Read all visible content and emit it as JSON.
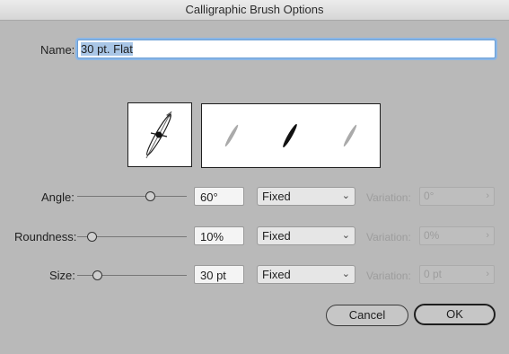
{
  "window": {
    "title": "Calligraphic Brush Options"
  },
  "name": {
    "label": "Name:",
    "value": "30 pt. Flat"
  },
  "rows": [
    {
      "label": "Angle:",
      "value": "60°",
      "mode": "Fixed",
      "variation_label": "Variation:",
      "variation_value": "0°",
      "slider_fraction": 0.65
    },
    {
      "label": "Roundness:",
      "value": "10%",
      "mode": "Fixed",
      "variation_label": "Variation:",
      "variation_value": "0%",
      "slider_fraction": 0.1
    },
    {
      "label": "Size:",
      "value": "30 pt",
      "mode": "Fixed",
      "variation_label": "Variation:",
      "variation_value": "0 pt",
      "slider_fraction": 0.15
    }
  ],
  "buttons": {
    "cancel": "Cancel",
    "ok": "OK"
  },
  "icons": {
    "dropdown": "chevron-down-icon",
    "variation_stepper": "chevron-right-icon"
  }
}
